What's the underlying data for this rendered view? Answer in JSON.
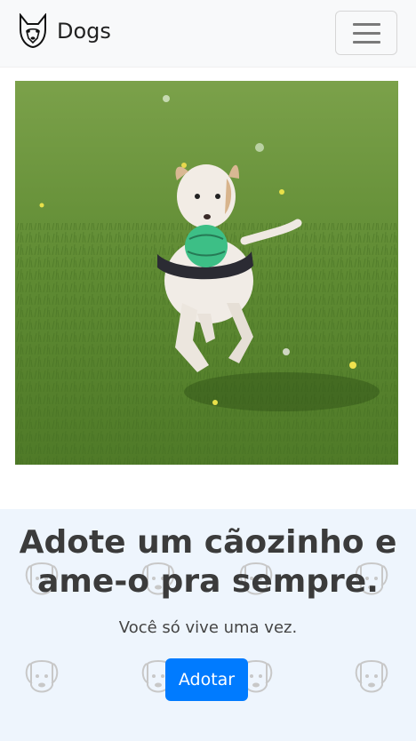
{
  "navbar": {
    "brand_name": "Dogs",
    "logo_icon": "husky-head-icon",
    "menu_icon": "hamburger-menu-icon"
  },
  "hero": {
    "image_subject": "dog-running-on-grass-with-ball"
  },
  "cta": {
    "title": "Adote um cãozinho e ame-o pra sempre.",
    "subtitle": "Você só vive uma vez.",
    "button_label": "Adotar",
    "background_icon": "dog-face-outline-icon"
  },
  "colors": {
    "navbar_bg": "#f8f9fa",
    "cta_bg": "#eef5fd",
    "button_bg": "#007bff",
    "grass": "#5d8a33"
  }
}
